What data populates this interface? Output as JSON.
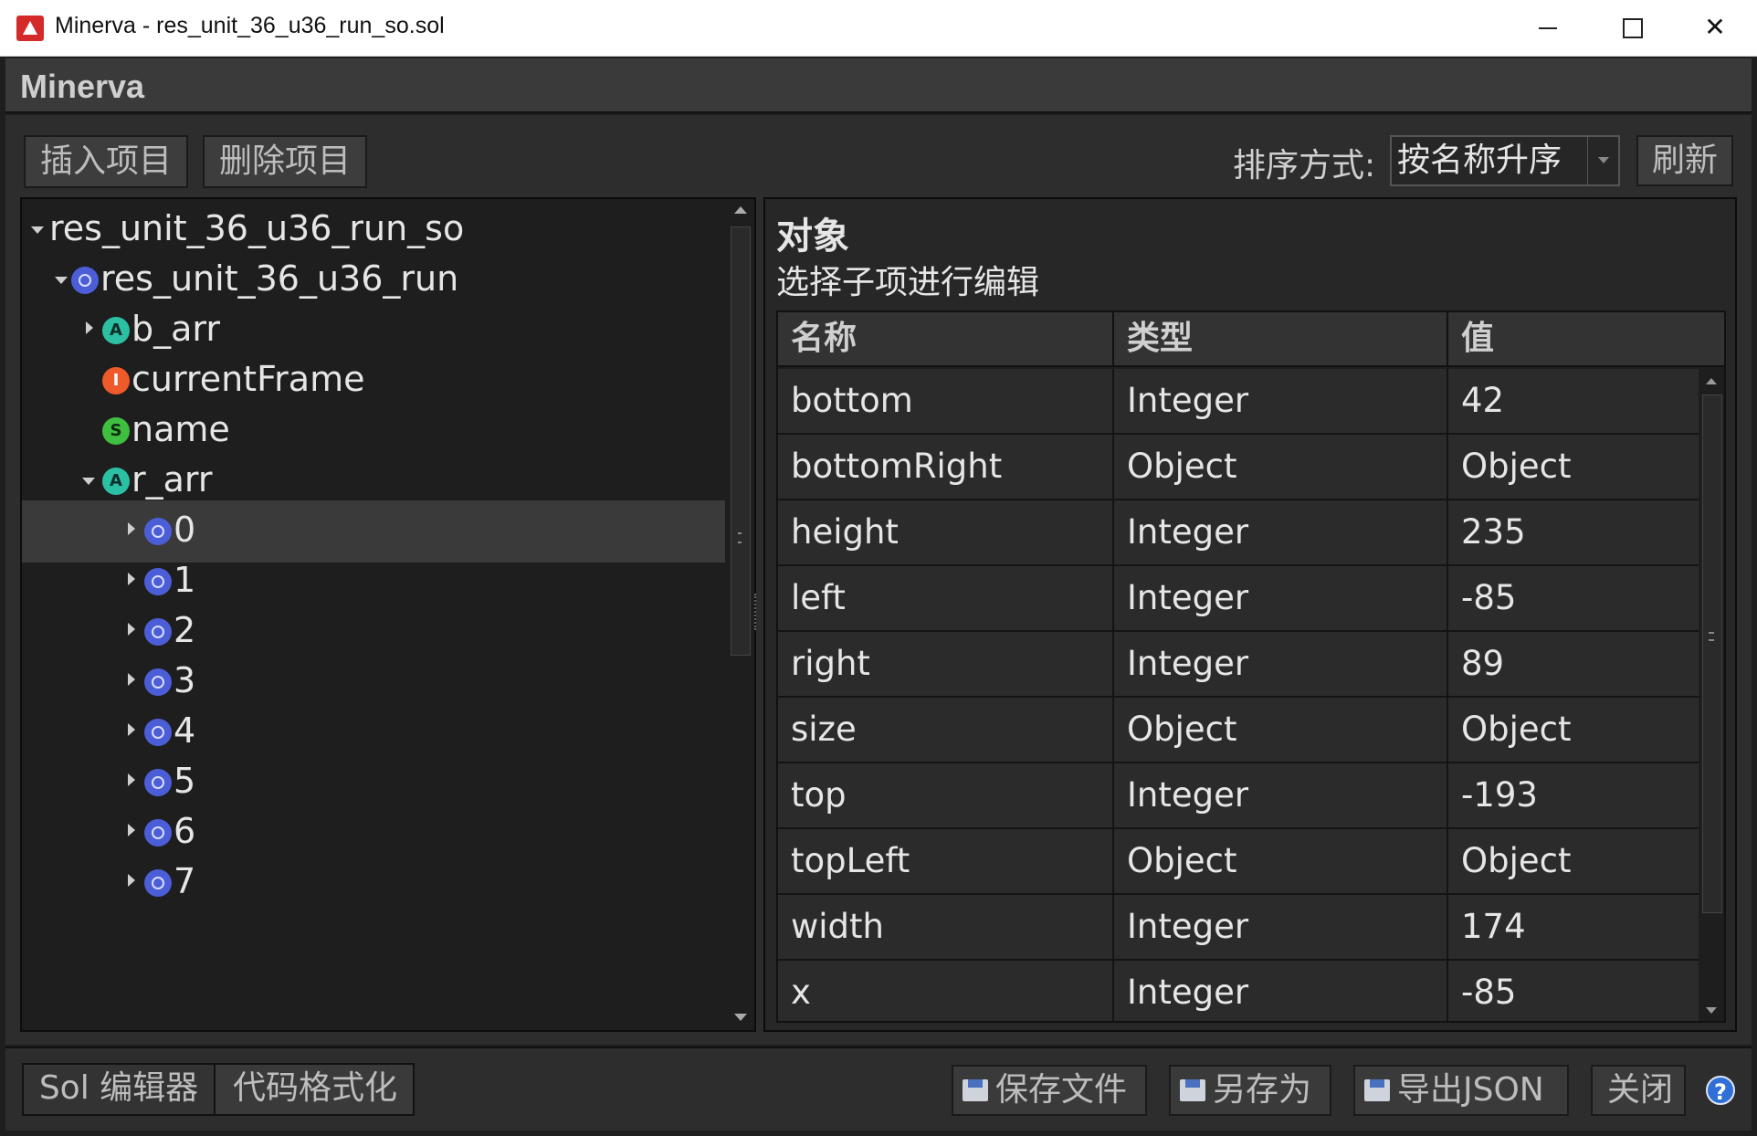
{
  "window": {
    "title": "Minerva - res_unit_36_u36_run_so.sol",
    "minimize_icon": "minimize-icon",
    "maximize_icon": "maximize-icon",
    "close_icon": "close-icon"
  },
  "app": {
    "brand": "Minerva"
  },
  "toolbar": {
    "insert_label": "插入项目",
    "delete_label": "删除项目",
    "sort_label": "排序方式:",
    "sort_value": "按名称升序",
    "refresh_label": "刷新"
  },
  "tree": {
    "items": [
      {
        "label": "res_unit_36_u36_run_so",
        "badge": "",
        "expanded": true
      },
      {
        "label": "res_unit_36_u36_run",
        "badge": "",
        "expanded": true
      },
      {
        "label": "b_arr",
        "badge": "A",
        "expanded": false
      },
      {
        "label": "currentFrame",
        "badge": "I"
      },
      {
        "label": "name",
        "badge": "S"
      },
      {
        "label": "r_arr",
        "badge": "A",
        "expanded": true
      },
      {
        "label": "0",
        "badge": "",
        "expanded": false,
        "selected": true
      },
      {
        "label": "1",
        "badge": "",
        "expanded": false
      },
      {
        "label": "2",
        "badge": "",
        "expanded": false
      },
      {
        "label": "3",
        "badge": "",
        "expanded": false
      },
      {
        "label": "4",
        "badge": "",
        "expanded": false
      },
      {
        "label": "5",
        "badge": "",
        "expanded": false
      },
      {
        "label": "6",
        "badge": "",
        "expanded": false
      },
      {
        "label": "7",
        "badge": "",
        "expanded": false
      }
    ]
  },
  "details": {
    "title": "对象",
    "subtitle": "选择子项进行编辑",
    "columns": [
      "名称",
      "类型",
      "值"
    ],
    "rows": [
      {
        "name": "bottom",
        "type": "Integer",
        "value": "42"
      },
      {
        "name": "bottomRight",
        "type": "Object",
        "value": "Object"
      },
      {
        "name": "height",
        "type": "Integer",
        "value": "235"
      },
      {
        "name": "left",
        "type": "Integer",
        "value": "-85"
      },
      {
        "name": "right",
        "type": "Integer",
        "value": "89"
      },
      {
        "name": "size",
        "type": "Object",
        "value": "Object"
      },
      {
        "name": "top",
        "type": "Integer",
        "value": "-193"
      },
      {
        "name": "topLeft",
        "type": "Object",
        "value": "Object"
      },
      {
        "name": "width",
        "type": "Integer",
        "value": "174"
      },
      {
        "name": "x",
        "type": "Integer",
        "value": "-85"
      }
    ]
  },
  "bottom": {
    "tab_editor": "Sol 编辑器",
    "tab_format": "代码格式化",
    "save_label": "保存文件",
    "saveas_label": "另存为",
    "export_label": "导出JSON",
    "close_label": "关闭",
    "help_label": "?"
  },
  "colors": {
    "accent_object": "#4b5ed8",
    "accent_array": "#2bbfa4",
    "accent_integer": "#ee5a2a",
    "accent_string": "#3fbf3f"
  }
}
